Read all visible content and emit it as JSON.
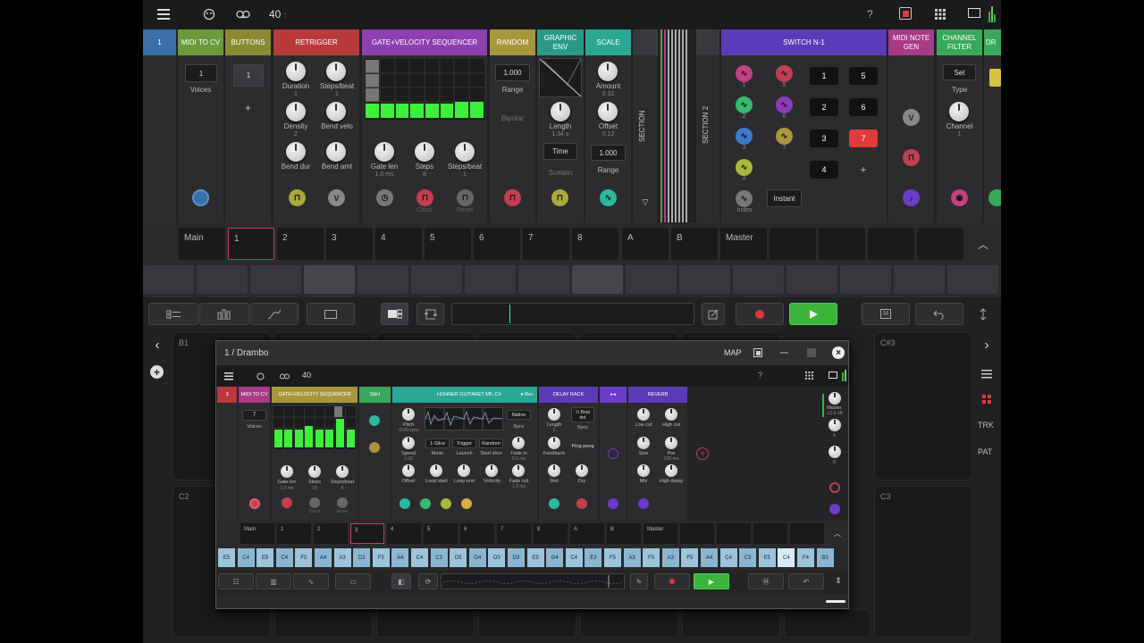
{
  "topbar": {
    "tempo": "40",
    "tempo_suffix": ":",
    "help": "?"
  },
  "modules": [
    {
      "id": "m1",
      "title": "1",
      "color": "#3a6fa8"
    },
    {
      "id": "midi-to-cv",
      "title": "MIDI TO CV",
      "color": "#6a9a3c",
      "voices_value": "1",
      "voices_label": "Voices"
    },
    {
      "id": "buttons",
      "title": "BUTTONS",
      "color": "#8a8a32",
      "value": "1",
      "plus": "+"
    },
    {
      "id": "retrigger",
      "title": "RETRIGGER",
      "color": "#b83a3a",
      "knobs": [
        {
          "label": "Duration",
          "value": "1"
        },
        {
          "label": "Steps/beat",
          "value": "1"
        },
        {
          "label": "Density",
          "value": "2"
        },
        {
          "label": "Bend velo",
          "value": ""
        },
        {
          "label": "Bend dur",
          "value": ""
        },
        {
          "label": "Bend amt",
          "value": ""
        }
      ]
    },
    {
      "id": "gate-velocity-sequencer",
      "title": "GATE+VELOCITY SEQUENCER",
      "color": "#8e3fb0",
      "knobs": [
        {
          "label": "Gate len",
          "value": "1.0 ms"
        },
        {
          "label": "Steps",
          "value": "8"
        },
        {
          "label": "Steps/beat",
          "value": "1"
        }
      ],
      "ports": {
        "clock": "Clock",
        "reset": "Reset"
      }
    },
    {
      "id": "random",
      "title": "RANDOM",
      "color": "#a8963c",
      "value": "1.000",
      "range": "Range",
      "bipolar": "Bipolar"
    },
    {
      "id": "graphic-env",
      "title": "GRAPHIC ENV",
      "color": "#2a9a86",
      "length_label": "Length",
      "length_value": "1.34 s",
      "time": "Time",
      "sustain": "Sustain"
    },
    {
      "id": "scale",
      "title": "SCALE",
      "color": "#2aa894",
      "amount_label": "Amount",
      "amount_value": "0.31",
      "offset_label": "Offset",
      "offset_value": "0.12",
      "range_value": "1.000",
      "range_label": "Range"
    },
    {
      "id": "section",
      "title": "SECTION"
    },
    {
      "id": "section-2",
      "title": "SECTION 2"
    },
    {
      "id": "switch-n-1",
      "title": "SWITCH N-1",
      "color": "#5a3cb8",
      "buttons": [
        "1",
        "5",
        "2",
        "6",
        "3",
        "7",
        "4"
      ],
      "plus": "+",
      "instant": "Instant",
      "index": "Index",
      "port_numbers": [
        "1",
        "5",
        "2",
        "6",
        "3",
        "7",
        "4"
      ]
    },
    {
      "id": "midi-note-gen",
      "title": "MIDI NOTE GEN",
      "color": "#a83a86"
    },
    {
      "id": "channel-filter",
      "title": "CHANNEL FILTER",
      "color": "#3aa85a",
      "set": "Set",
      "type": "Type",
      "channel_label": "Channel",
      "channel_value": "1"
    },
    {
      "id": "dr",
      "title": "DR",
      "color": "#3aa85a"
    }
  ],
  "tabs": [
    "Main",
    "1",
    "2",
    "3",
    "4",
    "5",
    "6",
    "7",
    "8",
    "A",
    "B",
    "Master"
  ],
  "bg_pads": {
    "b1": "B1",
    "cs3": "C#3",
    "c2": "C2",
    "c3": "C3"
  },
  "side": {
    "trk": "TRK",
    "pat": "PAT"
  },
  "popup": {
    "title": "1 / Drambo",
    "map": "MAP",
    "tempo": "40",
    "tempo_suffix": ":",
    "help": "?",
    "modules": {
      "m3": "3",
      "midi_to_cv": {
        "title": "MIDI TO CV",
        "voices_value": "7",
        "voices_label": "Voices"
      },
      "gvs": {
        "title": "GATE+VELOCITY SEQUENCER",
        "knobs": [
          {
            "label": "Gate len",
            "value": "1.0 ms"
          },
          {
            "label": "Steps",
            "value": "10"
          },
          {
            "label": "Steps/beat",
            "value": "8"
          }
        ],
        "clock": "Clock",
        "reset": "Reset"
      },
      "sh": {
        "title": "S&H"
      },
      "sampler": {
        "title": "HOHNER GUITARET MF, C4",
        "rec": "● Rec",
        "pitch_label": "Pitch",
        "pitch_value": "-0.99 semi",
        "native": "Native",
        "sync": "Sync",
        "speed_label": "Speed",
        "speed_value": "1.00",
        "mode_value": "1-Slice",
        "mode_label": "Mode",
        "launch_value": "Trigger",
        "launch_label": "Launch",
        "start_value": "Random",
        "start_label": "Start slice",
        "fadein_label": "Fade in",
        "fadein_value": "0.0 ms",
        "offset": "Offset",
        "loop_start": "Loop start",
        "loop_end": "Loop end",
        "velocity": "Velocity",
        "fadeout_label": "Fade out",
        "fadeout_value": "1.0 ms"
      },
      "delay": {
        "title": "DELAY RACK",
        "length_label": "Length",
        "length_value": "2",
        "beat": "¼ Beat",
        "dot": "dot",
        "sync": "Sync",
        "feedback": "Feedback",
        "pingpong": "Ping-pong",
        "wet": "Wet",
        "dry": "Dry"
      },
      "split": {
        "title": "▸◂"
      },
      "reverb": {
        "title": "REVERB",
        "lowcut": "Low cut",
        "highcut": "High cut",
        "size": "Size",
        "pre": "Pre",
        "pre_value": "200 ms",
        "mix": "Mix",
        "highdamp": "High damp"
      },
      "master": {
        "label": "Master",
        "value": "-12.6 dB",
        "a": "A",
        "b": "B"
      }
    },
    "tabs": [
      "Main",
      "1",
      "2",
      "3",
      "4",
      "5",
      "6",
      "7",
      "8",
      "A",
      "B",
      "Master"
    ],
    "keys": [
      "E5",
      "C4",
      "E5",
      "C4",
      "F5",
      "A4",
      "A3",
      "D3",
      "F5",
      "A4",
      "C4",
      "C3",
      "D5",
      "G4",
      "D3",
      "D3",
      "E5",
      "G4",
      "C4",
      "E3",
      "F5",
      "A3",
      "F5",
      "A3",
      "F5",
      "A4",
      "C4",
      "C3",
      "E5",
      "C4",
      "F4",
      "B3"
    ]
  }
}
